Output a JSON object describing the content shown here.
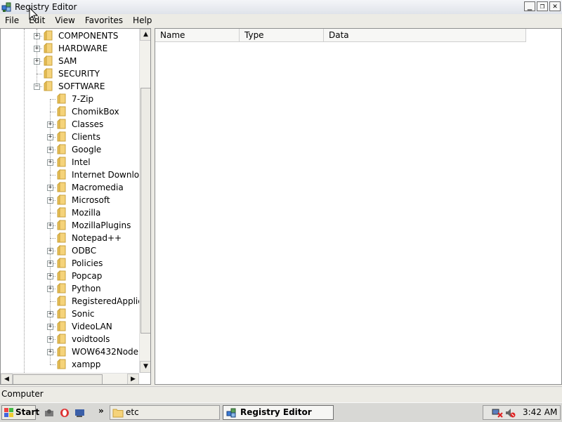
{
  "window": {
    "title": "Registry Editor",
    "buttons": [
      "_",
      "❐",
      "✕"
    ]
  },
  "menubar": {
    "items": [
      "File",
      "Edit",
      "View",
      "Favorites",
      "Help"
    ]
  },
  "tree": {
    "items": [
      {
        "label": "COMPONENTS",
        "level": 1,
        "expander": "+"
      },
      {
        "label": "HARDWARE",
        "level": 1,
        "expander": "+"
      },
      {
        "label": "SAM",
        "level": 1,
        "expander": "+"
      },
      {
        "label": "SECURITY",
        "level": 1,
        "expander": ""
      },
      {
        "label": "SOFTWARE",
        "level": 1,
        "expander": "−"
      },
      {
        "label": "7-Zip",
        "level": 2,
        "expander": ""
      },
      {
        "label": "ChomikBox",
        "level": 2,
        "expander": ""
      },
      {
        "label": "Classes",
        "level": 2,
        "expander": "+"
      },
      {
        "label": "Clients",
        "level": 2,
        "expander": "+"
      },
      {
        "label": "Google",
        "level": 2,
        "expander": "+"
      },
      {
        "label": "Intel",
        "level": 2,
        "expander": "+"
      },
      {
        "label": "Internet Downloac",
        "level": 2,
        "expander": ""
      },
      {
        "label": "Macromedia",
        "level": 2,
        "expander": "+"
      },
      {
        "label": "Microsoft",
        "level": 2,
        "expander": "+"
      },
      {
        "label": "Mozilla",
        "level": 2,
        "expander": ""
      },
      {
        "label": "MozillaPlugins",
        "level": 2,
        "expander": "+"
      },
      {
        "label": "Notepad++",
        "level": 2,
        "expander": ""
      },
      {
        "label": "ODBC",
        "level": 2,
        "expander": "+"
      },
      {
        "label": "Policies",
        "level": 2,
        "expander": "+"
      },
      {
        "label": "Popcap",
        "level": 2,
        "expander": "+"
      },
      {
        "label": "Python",
        "level": 2,
        "expander": "+"
      },
      {
        "label": "RegisteredApplica",
        "level": 2,
        "expander": ""
      },
      {
        "label": "Sonic",
        "level": 2,
        "expander": "+"
      },
      {
        "label": "VideoLAN",
        "level": 2,
        "expander": "+"
      },
      {
        "label": "voidtools",
        "level": 2,
        "expander": "+"
      },
      {
        "label": "WOW6432Node",
        "level": 2,
        "expander": "+"
      },
      {
        "label": "xampp",
        "level": 2,
        "expander": ""
      }
    ]
  },
  "list": {
    "columns": [
      "Name",
      "Type",
      "Data"
    ]
  },
  "status": {
    "path": "Computer"
  },
  "taskbar": {
    "start_label": "Start",
    "tasks": [
      {
        "label": "etc",
        "active": false
      },
      {
        "label": "Registry Editor",
        "active": true
      }
    ],
    "overflow": "»",
    "clock": "3:42 AM"
  },
  "icons": {
    "folder": "folder-icon",
    "app": "registry-editor-icon"
  },
  "colors": {
    "folder": "#f5d37a",
    "folder_edge": "#c9a23c"
  }
}
